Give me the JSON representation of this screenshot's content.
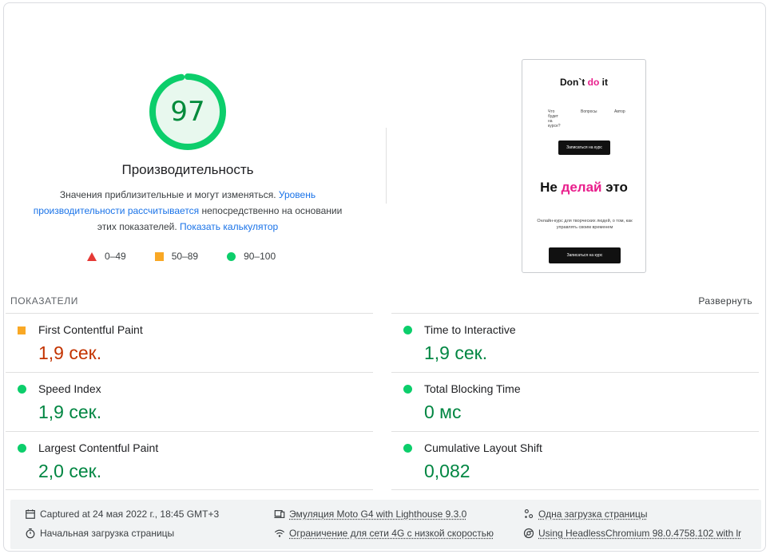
{
  "gauge": {
    "score": "97",
    "score_fraction": 0.97,
    "title": "Производительность",
    "desc_pre": "Значения приблизительные и могут изменяться. ",
    "desc_link1": "Уровень производительности рассчитывается",
    "desc_mid": " непосредственно на основании этих показателей. ",
    "desc_link2": "Показать калькулятор",
    "color": "#0cce6b"
  },
  "legend": [
    {
      "range": "0–49",
      "icon": "fail-triangle-icon",
      "color": "#e53935"
    },
    {
      "range": "50–89",
      "icon": "average-square-icon",
      "color": "#f9a825"
    },
    {
      "range": "90–100",
      "icon": "pass-circle-icon",
      "color": "#0cce6b"
    }
  ],
  "preview": {
    "logo_a": "Don`t ",
    "logo_b": "do",
    "logo_c": " it",
    "nav": [
      "Что будет на курсе?",
      "Вопросы",
      "Автор"
    ],
    "button1": "Записаться на курс",
    "headline_a": "Не ",
    "headline_b": "делай",
    "headline_c": " это",
    "sub": "Онлайн-курс для творческих людей, о том, как управлять своим временем",
    "button2": "Записаться на курс"
  },
  "metrics_header": {
    "title": "ПОКАЗАТЕЛИ",
    "expand": "Развернуть"
  },
  "metrics": [
    {
      "label": "First Contentful Paint",
      "value": "1,9 сек.",
      "status": "average"
    },
    {
      "label": "Time to Interactive",
      "value": "1,9 сек.",
      "status": "pass"
    },
    {
      "label": "Speed Index",
      "value": "1,9 сек.",
      "status": "pass"
    },
    {
      "label": "Total Blocking Time",
      "value": "0 мс",
      "status": "pass"
    },
    {
      "label": "Largest Contentful Paint",
      "value": "2,0 сек.",
      "status": "pass"
    },
    {
      "label": "Cumulative Layout Shift",
      "value": "0,082",
      "status": "pass"
    }
  ],
  "footer": {
    "captured": "Captured at 24 мая 2022 г., 18:45 GMT+3",
    "emulation": "Эмуляция Moto G4 with Lighthouse 9.3.0",
    "single_load": "Одна загрузка страницы",
    "initial_load": "Начальная загрузка страницы",
    "throttling": "Ограничение для сети 4G с низкой скоростью",
    "browser": "Using HeadlessChromium 98.0.4758.102 with lr"
  }
}
